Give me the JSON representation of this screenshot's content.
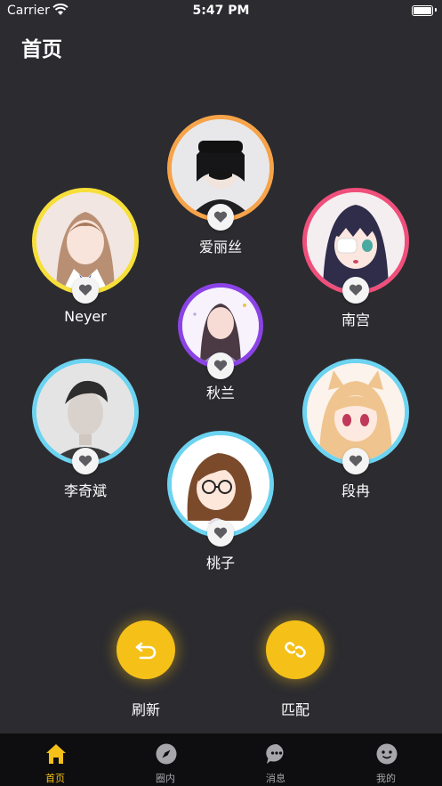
{
  "status_bar": {
    "carrier": "Carrier",
    "time": "5:47 PM"
  },
  "header": {
    "title": "首页"
  },
  "profiles": [
    {
      "name": "爱丽丝",
      "ring_color": "#f6a34a"
    },
    {
      "name": "Neyer",
      "ring_color": "#f7df3a"
    },
    {
      "name": "南宫",
      "ring_color": "#ef4f7b"
    },
    {
      "name": "秋兰",
      "ring_color": "#8b43e6"
    },
    {
      "name": "李奇斌",
      "ring_color": "#6cd3f0"
    },
    {
      "name": "段冉",
      "ring_color": "#6cd3f0"
    },
    {
      "name": "桃子",
      "ring_color": "#6cd3f0"
    }
  ],
  "actions": {
    "refresh_label": "刷新",
    "match_label": "匹配"
  },
  "tabbar": {
    "items": [
      {
        "label": "首页",
        "icon": "home-icon",
        "active": true
      },
      {
        "label": "圈内",
        "icon": "compass-icon",
        "active": false
      },
      {
        "label": "消息",
        "icon": "chat-icon",
        "active": false
      },
      {
        "label": "我的",
        "icon": "profile-icon",
        "active": false
      }
    ]
  },
  "colors": {
    "background": "#2b2b30",
    "accent": "#f5c018",
    "tab_inactive": "#a7a7ab"
  }
}
